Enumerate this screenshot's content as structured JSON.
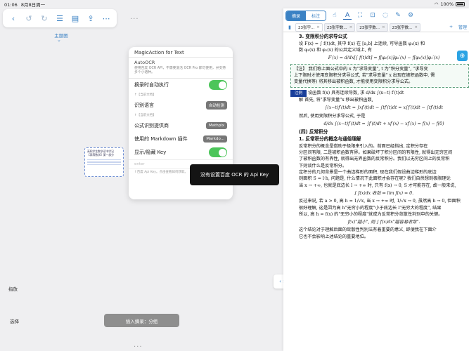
{
  "status_bar": {
    "time": "01:06",
    "date": "8月8日周一",
    "battery": "100%"
  },
  "left_toolbar": {
    "icons": [
      "back-icon",
      "undo-icon",
      "redo-icon",
      "list-icon",
      "outline-icon",
      "share-icon",
      "more-icon"
    ]
  },
  "mindmap": {
    "topic_label": "主题图",
    "node_text": "高职学生数学读书学记",
    "node_text2": "【高等数学】第一部分"
  },
  "magic_panel": {
    "title": "MagicAction for Text",
    "ocr_title": "AutoOCR",
    "ocr_desc": "使用百度 OCR API，不需要激活 OCR Pro 即可使用，并支持多个小语种。",
    "auto_exec_label": "摘录时自动执行",
    "current_lang_hint": "↑【当前文档】",
    "recognition_label": "识别语言",
    "recognition_value": "自动检测",
    "formula_hint": "↑【当前文档】",
    "formula_provider_label": "公式识别提供商",
    "formula_provider_value": "Mathpix",
    "markdown_label": "使用的 Markdown 插件",
    "markdown_value": "Markdo...",
    "key_label": "显示/隐藏 Key",
    "input_placeholder": "enter",
    "footer_hint": "↑百度 Api Key。点击查看如何获取。"
  },
  "toast": {
    "message": "没有设置百度 OCR 的 Api Key"
  },
  "bottom": {
    "zoom_label": "指放",
    "select_label": "选择",
    "insert_label": "插入摘录：分组"
  },
  "reader": {
    "tabs": {
      "excerpt": "摘录",
      "annotate": "标注"
    },
    "doc_tabs": [
      "23张宇...",
      "23张宇数...",
      "23张宇数...",
      "23张宇数..."
    ],
    "manage_label": "管理",
    "page_lines": {
      "h3": "3. 变限积分的求导公式",
      "l1": "设 F(x) = ∫ f(t)dt, 其中 f(x) 在 [a,b] 上连续, 可导函数 φ₁(x) 和",
      "l2": "数 φ₁(x) 和 φ₂(x) 的公共定义域上, 有",
      "eq1": "F′(x) = d/dx[∫ f(t)dt] = f[φ₂(x)]φ₂′(x) − f[φ₁(x)]φ₁′(x)",
      "note1": "【注】  我们称上面公式中的 x 为\"求导变量\", t 为\"积分变量\", \"求导变",
      "note2": "上下限时才使用变限积分求导公式, 若\"求导变量\" x 出现在被积函数中, 需",
      "note3": "变量代换等) 将其移出被积函数, 才能使用变限积分求导公式。",
      "example_tag": "注例",
      "ex1": "设函数 f(x) 具有连续导数, 求 d/dx ∫(x−t) f′(t)dt",
      "sol1": "解  首先, 将\"求导变量\"x 移出被积函数,",
      "eq2": "∫(x−t)f′(t)dt = ∫xf′(t)dt − ∫tf′(t)dt = x∫f′(t)dt − ∫tf′(t)dt",
      "sol2": "然后, 使用变限积分求导公式, 于是",
      "eq3": "d/dx ∫(x−t)f′(t)dt = ∫f′(t)dt + xf′(x) − xf′(x) = f(x) − f(0)",
      "h4": "(四) 反常积分",
      "h5": "1. 反常积分的概念与通俗理解",
      "p1": "反常积分的概念是借助于极限来引入的。前面已经指出, 定积分存在",
      "p2": "分区间有限, 二是被积函数有界。如果破坏了积分区间的有限性, 就得出无穷区间",
      "p3": "了被积函数的有界性, 就得出无界函数的反常积分。我们以无穷区间上的反常积",
      "p4": "下则谈什么是反常积分。",
      "p5": "定积分的几何背景是一个曲边梯形的面积, 现在我们假设曲边梯形的底边",
      "p6": "则面积 S = l·h, 问题是, 什么情况下此面积才会存在呢? 我们自然想到极限理论",
      "p7": "当 x → +∞, 也就是底边长 l → +∞ 时, 只有 f(x) → 0, S 才可能存在, 故一般来说,",
      "eq4": "∫ f(x)dx 收敛 ⇒ lim f(x) = 0.",
      "p8": "反过来说, 若 a > 0, 高 h = 1/√x, 当 x → +∞ 时, 1/√x → 0, 虽然高 h → 0, 但面积",
      "p9": "很好理解, 这是因为高 h\"无穷小的程度\"小于底边长 l\"无穷大的程度\", 结果",
      "p10": "所以, 高 h = f(x) 的\"无穷小的程度\"就成为反常积分敛散性判别中的关键。",
      "eq5": "f(x)\"越小\", 则 ∫ f(x)dx\"越容易收敛\".",
      "p11": "这个结论对于理解后面的敛散性判别法有着重要的意义, 即便我在下面介",
      "p12": "它也不会影响上述结论的重要地位。"
    }
  }
}
